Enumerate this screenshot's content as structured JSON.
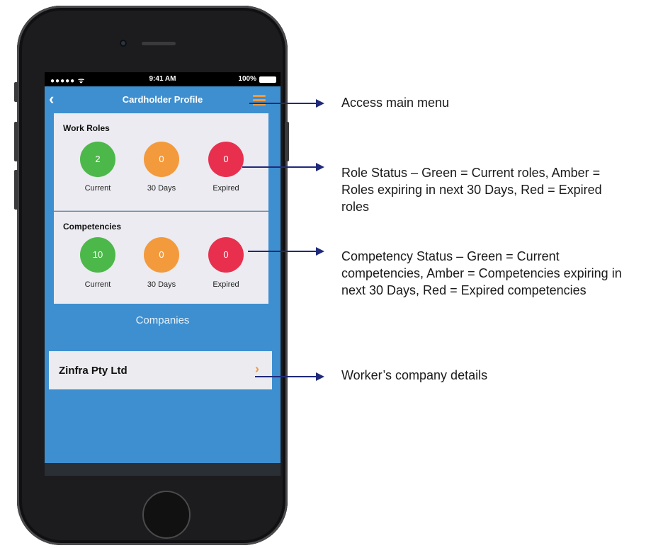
{
  "status_bar": {
    "signal": "●●●●● ᯤ",
    "time": "9:41 AM",
    "battery": "100%"
  },
  "nav": {
    "back_icon": "‹",
    "title": "Cardholder Profile"
  },
  "work_roles": {
    "heading": "Work Roles",
    "items": [
      {
        "value": "2",
        "label": "Current",
        "color": "#4cb84a"
      },
      {
        "value": "0",
        "label": "30 Days",
        "color": "#f39a3c"
      },
      {
        "value": "0",
        "label": "Expired",
        "color": "#e8304e"
      }
    ]
  },
  "competencies": {
    "heading": "Competencies",
    "items": [
      {
        "value": "10",
        "label": "Current",
        "color": "#4cb84a"
      },
      {
        "value": "0",
        "label": "30 Days",
        "color": "#f39a3c"
      },
      {
        "value": "0",
        "label": "Expired",
        "color": "#e8304e"
      }
    ]
  },
  "companies": {
    "title": "Companies",
    "items": [
      {
        "name": "Zinfra Pty Ltd",
        "chevron": "›"
      }
    ]
  },
  "annotations": {
    "menu": "Access main menu",
    "roles": "Role Status – Green = Current roles, Amber = Roles expiring in next 30 Days, Red = Expired roles",
    "competencies": "Competency Status – Green = Current competencies, Amber = Competencies expiring in next 30 Days, Red = Expired competencies",
    "company": "Worker’s company details"
  }
}
